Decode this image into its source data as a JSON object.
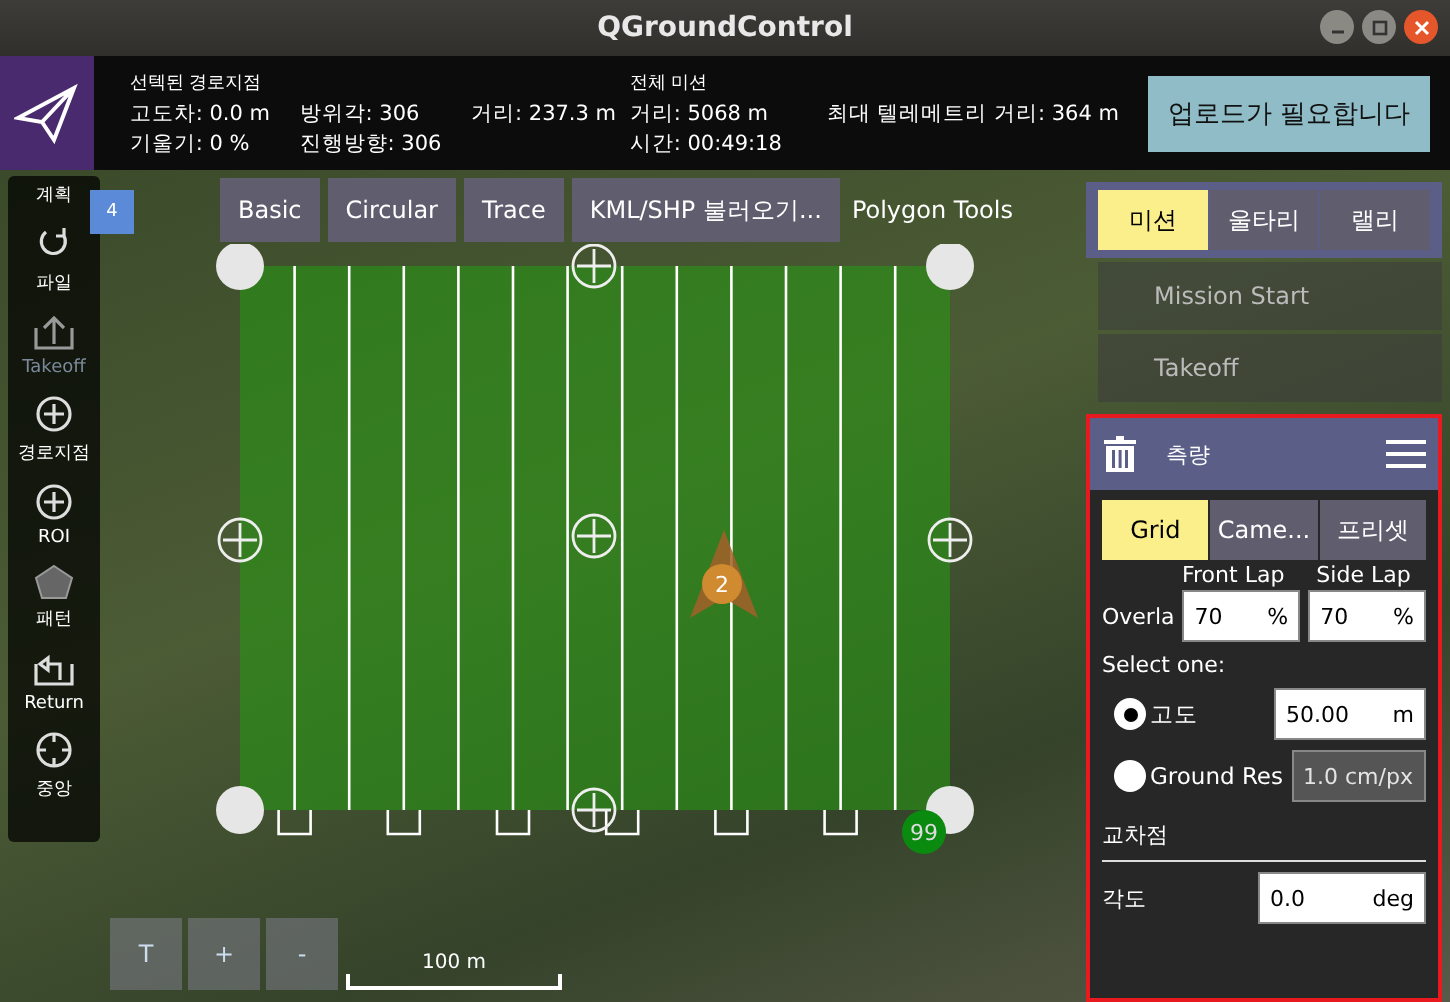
{
  "window": {
    "title": "QGroundControl"
  },
  "toolbar": {
    "selected_header": "선텍된 경로지점",
    "selected_stats": [
      {
        "label": "고도차:",
        "value": "0.0 m"
      },
      {
        "label": "방위각:",
        "value": "306"
      },
      {
        "label": "거리:",
        "value": "237.3 m"
      },
      {
        "label": "기울기:",
        "value": "0 %"
      },
      {
        "label": "진행방향:",
        "value": "306"
      }
    ],
    "mission_header": "전체 미션",
    "mission_stats": [
      {
        "label": "거리:",
        "value": "5068 m"
      },
      {
        "label": "최대 텔레메트리 거리:",
        "value": "364 m"
      },
      {
        "label": "시간:",
        "value": "00:49:18"
      }
    ],
    "upload_button": "업로드가 필요합니다"
  },
  "plan_tools": {
    "header": "계획",
    "items": [
      {
        "kind": "file",
        "label": "파일",
        "disabled": false
      },
      {
        "kind": "takeoff",
        "label": "Takeoff",
        "disabled": true
      },
      {
        "kind": "plus",
        "label": "경로지점",
        "disabled": false
      },
      {
        "kind": "plus",
        "label": "ROI",
        "disabled": false
      },
      {
        "kind": "pattern",
        "label": "패턴",
        "disabled": false
      },
      {
        "kind": "return",
        "label": "Return",
        "disabled": false
      },
      {
        "kind": "center",
        "label": "중앙",
        "disabled": false
      }
    ],
    "badge": "4"
  },
  "polygon_tools": {
    "buttons": [
      "Basic",
      "Circular",
      "Trace",
      "KML/SHP 불러오기..."
    ],
    "label": "Polygon Tools"
  },
  "map": {
    "vehicle_marker": "2",
    "landing_marker": "99",
    "scale": "100 m",
    "zoom_buttons": [
      "T",
      "+",
      "-"
    ]
  },
  "mission_tabs": [
    {
      "label": "미션",
      "selected": true
    },
    {
      "label": "울타리",
      "selected": false
    },
    {
      "label": "랠리",
      "selected": false
    }
  ],
  "mission_items": [
    "Mission Start",
    "Takeoff"
  ],
  "survey": {
    "title": "측량",
    "tabs": [
      {
        "label": "Grid",
        "selected": true
      },
      {
        "label": "Came...",
        "selected": false
      },
      {
        "label": "프리셋",
        "selected": false
      }
    ],
    "front_lap_label": "Front Lap",
    "side_lap_label": "Side Lap",
    "overlap_label": "Overla",
    "front_lap": {
      "value": "70",
      "unit": "%"
    },
    "side_lap": {
      "value": "70",
      "unit": "%"
    },
    "select_label": "Select one:",
    "options": [
      {
        "label": "고도",
        "selected": true,
        "value": "50.00",
        "unit": "m",
        "disabled": false
      },
      {
        "label": "Ground Res",
        "selected": false,
        "value": "1.0 cm/px",
        "disabled": true
      }
    ],
    "section": "교차점",
    "angle_label": "각도",
    "angle": {
      "value": "0.0",
      "unit": "deg"
    }
  }
}
